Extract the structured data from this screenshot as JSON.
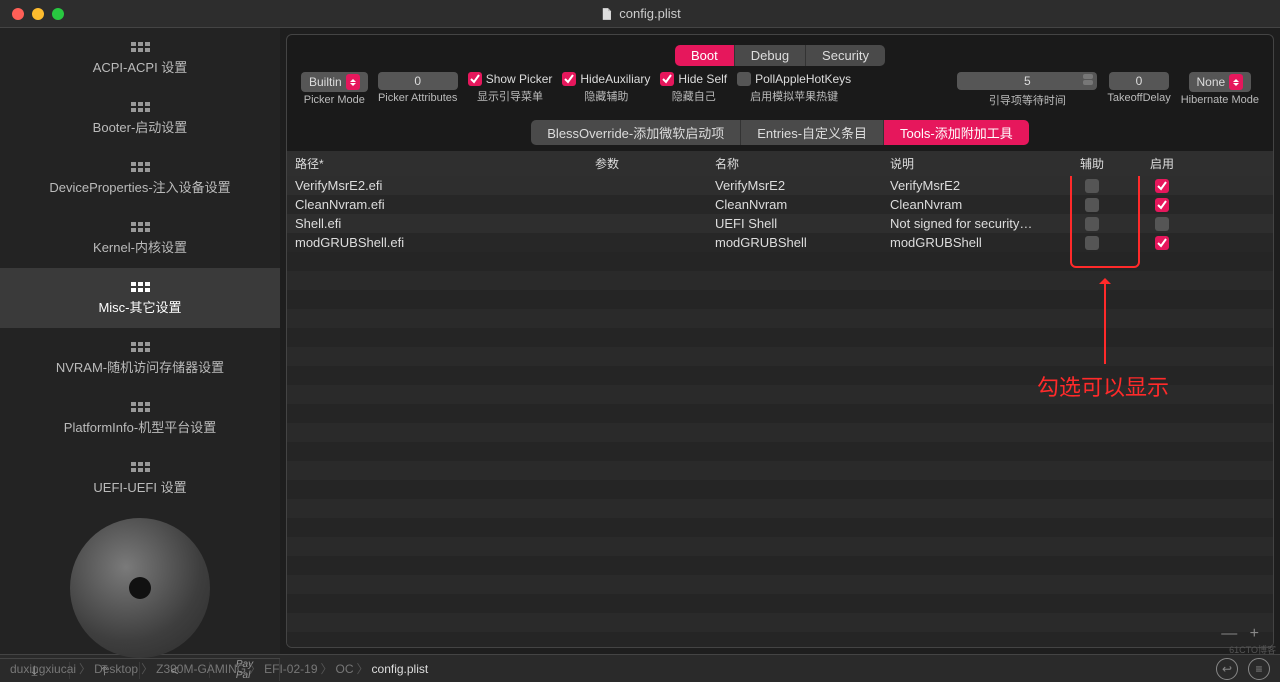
{
  "title": "config.plist",
  "sidebar": {
    "items": [
      {
        "label": "ACPI-ACPI 设置"
      },
      {
        "label": "Booter-启动设置"
      },
      {
        "label": "DeviceProperties-注入设备设置"
      },
      {
        "label": "Kernel-内核设置"
      },
      {
        "label": "Misc-其它设置"
      },
      {
        "label": "NVRAM-随机访问存储器设置"
      },
      {
        "label": "PlatformInfo-机型平台设置"
      },
      {
        "label": "UEFI-UEFI 设置"
      }
    ],
    "active_index": 4
  },
  "top_tabs": {
    "items": [
      "Boot",
      "Debug",
      "Security"
    ],
    "active_index": 0
  },
  "controls": {
    "picker_mode": {
      "value": "Builtin",
      "label": "Picker Mode"
    },
    "picker_attributes": {
      "value": "0",
      "label": "Picker Attributes"
    },
    "show_picker": {
      "title": "Show Picker",
      "sub": "显示引导菜单",
      "checked": true
    },
    "hide_auxiliary": {
      "title": "HideAuxiliary",
      "sub": "隐藏辅助",
      "checked": true
    },
    "hide_self": {
      "title": "Hide Self",
      "sub": "隐藏自己",
      "checked": true
    },
    "poll_apple": {
      "title": "PollAppleHotKeys",
      "sub": "启用模拟苹果热键",
      "checked": false
    },
    "wait_time": {
      "value": "5",
      "label": "引导项等待时间"
    },
    "takeoff_delay": {
      "value": "0",
      "label": "TakeoffDelay"
    },
    "hibernate_mode": {
      "value": "None",
      "label": "Hibernate Mode"
    }
  },
  "sub_tabs": {
    "items": [
      "BlessOverride-添加微软启动项",
      "Entries-自定义条目",
      "Tools-添加附加工具"
    ],
    "active_index": 2
  },
  "table": {
    "headers": {
      "path": "路径*",
      "params": "参数",
      "name": "名称",
      "desc": "说明",
      "aux": "辅助",
      "enable": "启用"
    },
    "rows": [
      {
        "path": "VerifyMsrE2.efi",
        "params": "",
        "name": "VerifyMsrE2",
        "desc": "VerifyMsrE2",
        "aux": false,
        "enable": true
      },
      {
        "path": "CleanNvram.efi",
        "params": "",
        "name": "CleanNvram",
        "desc": "CleanNvram",
        "aux": false,
        "enable": true
      },
      {
        "path": "Shell.efi",
        "params": "",
        "name": "UEFI Shell",
        "desc": "Not signed for security…",
        "aux": false,
        "enable": false
      },
      {
        "path": "modGRUBShell.efi",
        "params": "",
        "name": "modGRUBShell",
        "desc": "modGRUBShell",
        "aux": false,
        "enable": true
      }
    ]
  },
  "annotation": "勾选可以显示",
  "breadcrumb": [
    "duxingxiucai",
    "Desktop",
    "Z390M-GAMING",
    "EFI-02-19",
    "OC",
    "config.plist"
  ],
  "plus_minus": "— +",
  "watermark": "61CTO博客",
  "bottom_icons": [
    "export-icon",
    "import-icon",
    "share-icon",
    "paypal-icon"
  ]
}
